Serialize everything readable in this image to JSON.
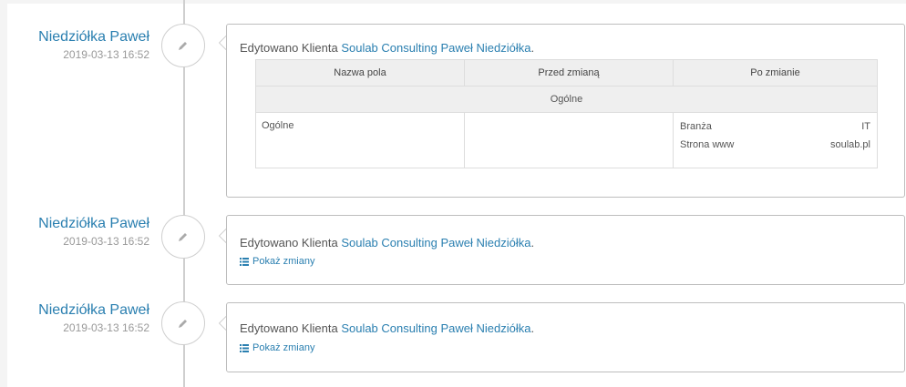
{
  "entries": [
    {
      "author": "Niedziółka Paweł",
      "datetime": "2019-03-13 16:52",
      "message_prefix": "Edytowano Klienta",
      "client_link": "Soulab Consulting Paweł Niedziółka",
      "message_suffix": ".",
      "changes_table": {
        "headers": [
          "Nazwa pola",
          "Przed zmianą",
          "Po zmianie"
        ],
        "group": "Ogólne",
        "field": "Ogólne",
        "before": "",
        "after": [
          {
            "label": "Branża",
            "value": "IT"
          },
          {
            "label": "Strona www",
            "value": "soulab.pl"
          }
        ]
      }
    },
    {
      "author": "Niedziółka Paweł",
      "datetime": "2019-03-13 16:52",
      "message_prefix": "Edytowano Klienta",
      "client_link": "Soulab Consulting Paweł Niedziółka",
      "message_suffix": ".",
      "show_changes_label": "Pokaż zmiany"
    },
    {
      "author": "Niedziółka Paweł",
      "datetime": "2019-03-13 16:52",
      "message_prefix": "Edytowano Klienta",
      "client_link": "Soulab Consulting Paweł Niedziółka",
      "message_suffix": ".",
      "show_changes_label": "Pokaż zmiany"
    }
  ],
  "colors": {
    "link": "#2a7fb0",
    "border": "#bdbdbd",
    "timeline": "#cfcfcf"
  }
}
